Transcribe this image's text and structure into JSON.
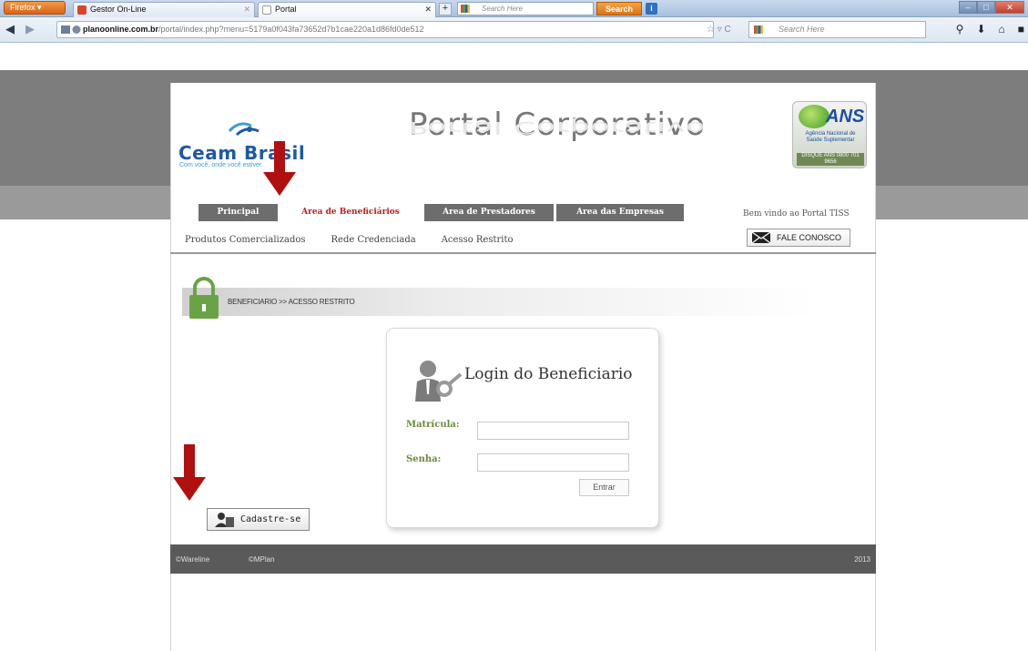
{
  "browser": {
    "menu_label": "Firefox",
    "tabs": [
      {
        "title": "Gestor On-Line"
      },
      {
        "title": "Portal"
      }
    ],
    "toolbar_search_placeholder": "Search Here",
    "toolbar_search_button": "Search",
    "url_host": "planoonline.com.br",
    "url_path": "/portal/index.php?menu=5179a0f043fa73652d7b1cae220a1d86fd0de512",
    "search_placeholder": "Search Here"
  },
  "header": {
    "logo_name": "Ceam Brasil",
    "logo_tagline": "Com você, onde você estiver.",
    "title": "Portal Corporativo",
    "ans_logo": "ANS",
    "ans_subtitle": "Agência Nacional de Saúde Suplementar",
    "ans_disque": "DISQUE ANS 0800 701 9656"
  },
  "tabs": [
    {
      "label": "Principal"
    },
    {
      "label": "Area de Beneficiários"
    },
    {
      "label": "Area de Prestadores"
    },
    {
      "label": "Area das Empresas"
    }
  ],
  "welcome": "Bem vindo ao Portal TISS",
  "subnav": [
    "Produtos Comercializados",
    "Rede Credenciada",
    "Acesso Restrito"
  ],
  "contact_button": "FALE CONOSCO",
  "breadcrumb": "BENEFICIARIO >> ACESSO RESTRITO",
  "login": {
    "title": "Login do Beneficiario",
    "matricula_label": "Matrícula:",
    "senha_label": "Senha:",
    "submit": "Entrar"
  },
  "register_button": "Cadastre-se",
  "footer": {
    "left1": "©Wareline",
    "left2": "©MPlan",
    "year": "2013"
  },
  "colors": {
    "active_tab_text": "#c41d1d",
    "arrow": "#b01010",
    "label_green": "#6a8a3a",
    "brand_blue": "#1d5aa6"
  }
}
